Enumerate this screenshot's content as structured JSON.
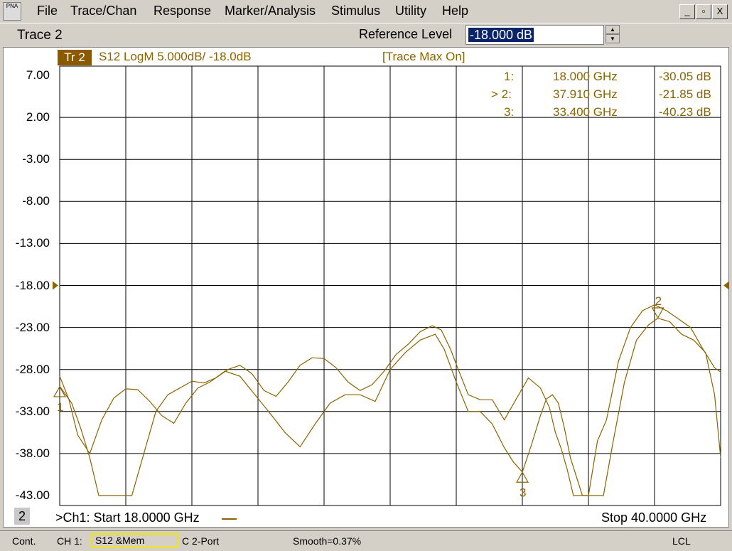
{
  "menu": {
    "app_icon_text": "PNA",
    "items": [
      "File",
      "Trace/Chan",
      "Response",
      "Marker/Analysis",
      "Stimulus",
      "Utility",
      "Help"
    ],
    "window_controls": [
      "_",
      "▫",
      "X"
    ]
  },
  "toolbar": {
    "trace_label": "Trace 2",
    "ref_label": "Reference Level",
    "ref_value": "-18.000 dB"
  },
  "chart_header": {
    "trace_badge": "Tr 2",
    "format": "S12 LogM 5.000dB/  -18.0dB",
    "trace_max": "[Trace Max On]"
  },
  "markers": [
    {
      "num": "1:",
      "freq": "18.000 GHz",
      "val": "-30.05 dB"
    },
    {
      "num": "> 2:",
      "freq": "37.910 GHz",
      "val": "-21.85 dB"
    },
    {
      "num": "3:",
      "freq": "33.400 GHz",
      "val": "-40.23 dB"
    }
  ],
  "chart_data": {
    "type": "line",
    "y_ticks": [
      "7.00",
      "2.00",
      "-3.00",
      "-8.00",
      "-13.00",
      "-18.00",
      "-23.00",
      "-28.00",
      "-33.00",
      "-38.00",
      "-43.00"
    ],
    "ylim": [
      -43,
      7
    ],
    "xlim": [
      18,
      40
    ],
    "x_unit": "GHz",
    "y_unit": "dB",
    "reference_level": -18,
    "grid": true,
    "colors": {
      "trace": "#8b6400",
      "grid": "#000000"
    },
    "series": [
      {
        "x": [
          18.0,
          18.3,
          18.6,
          19.0,
          19.4,
          19.8,
          20.2,
          20.6,
          21.0,
          21.4,
          21.8,
          22.2,
          22.6,
          23.0,
          23.5,
          24.0,
          24.5,
          25.0,
          25.5,
          26.0,
          26.5,
          27.0,
          27.5,
          28.0,
          28.5,
          29.0,
          29.5,
          30.0,
          30.5,
          30.8,
          31.2,
          31.6,
          32.0,
          32.4,
          32.8,
          33.1,
          33.4,
          33.7,
          34.0,
          34.2,
          34.4,
          34.6,
          34.8,
          35.0,
          35.4,
          35.8,
          36.1,
          36.4,
          36.8,
          37.2,
          37.6,
          37.91,
          38.3,
          38.7,
          39.1,
          39.5,
          39.8,
          40.0
        ],
        "y": [
          -28.8,
          -31.5,
          -35.8,
          -38.0,
          -34.0,
          -31.4,
          -30.3,
          -30.4,
          -31.8,
          -33.5,
          -34.4,
          -32.0,
          -30.2,
          -29.5,
          -28.2,
          -28.8,
          -31.0,
          -33.2,
          -35.5,
          -37.2,
          -34.5,
          -32.0,
          -31.0,
          -31.0,
          -31.8,
          -28.0,
          -26.0,
          -24.5,
          -23.8,
          -25.6,
          -29.5,
          -33.0,
          -33.0,
          -34.5,
          -37.3,
          -39.0,
          -40.2,
          -37.0,
          -33.5,
          -31.5,
          -31.0,
          -32.0,
          -35.0,
          -38.5,
          -43.0,
          -43.0,
          -43.0,
          -37.0,
          -29.5,
          -24.5,
          -22.7,
          -21.9,
          -22.3,
          -23.8,
          -24.5,
          -26.0,
          -31.0,
          -38.5
        ]
      },
      {
        "x": [
          18.0,
          18.4,
          18.7,
          19.0,
          19.3,
          19.6,
          20.0,
          20.4,
          20.8,
          21.2,
          21.6,
          22.0,
          22.4,
          22.8,
          23.2,
          23.6,
          24.0,
          24.4,
          24.8,
          25.2,
          25.6,
          26.0,
          26.4,
          26.8,
          27.2,
          27.6,
          28.0,
          28.4,
          28.8,
          29.2,
          29.6,
          30.0,
          30.4,
          30.7,
          31.0,
          31.3,
          31.6,
          32.0,
          32.4,
          32.8,
          33.2,
          33.6,
          34.0,
          34.3,
          34.5,
          34.7,
          34.9,
          35.1,
          35.3,
          35.6,
          35.9,
          36.2,
          36.6,
          37.0,
          37.4,
          37.8,
          38.2,
          38.6,
          39.0,
          39.4,
          39.8,
          40.0
        ],
        "y": [
          -30.0,
          -32.0,
          -35.0,
          -38.5,
          -43.0,
          -43.0,
          -43.0,
          -43.0,
          -38.0,
          -33.0,
          -31.0,
          -30.2,
          -29.4,
          -29.6,
          -29.0,
          -28.0,
          -27.5,
          -28.5,
          -30.5,
          -31.2,
          -29.5,
          -27.5,
          -26.6,
          -26.7,
          -27.8,
          -29.5,
          -30.5,
          -29.8,
          -28.2,
          -26.2,
          -25.0,
          -23.5,
          -22.8,
          -23.3,
          -25.5,
          -28.3,
          -31.0,
          -31.6,
          -31.6,
          -34.0,
          -31.5,
          -29.0,
          -30.2,
          -32.5,
          -35.5,
          -37.5,
          -40.0,
          -43.0,
          -43.0,
          -43.0,
          -36.5,
          -34.0,
          -27.0,
          -23.0,
          -21.0,
          -20.3,
          -21.0,
          -22.0,
          -23.0,
          -25.5,
          -27.8,
          -28.3
        ]
      }
    ],
    "marker_points": [
      {
        "label": "1",
        "x": 18.0,
        "y": -30.05
      },
      {
        "label": "2",
        "x": 37.91,
        "y": -21.85
      },
      {
        "label": "3",
        "x": 33.4,
        "y": -40.23
      }
    ]
  },
  "footer": {
    "channel_num": "2",
    "start": ">Ch1: Start  18.0000 GHz",
    "stop": "Stop  40.0000 GHz"
  },
  "status": {
    "mode": "Cont.",
    "ch": "CH 1:",
    "meas": "S12 &Mem",
    "cal": "C  2-Port",
    "smooth": "Smooth=0.37%",
    "lcl": "LCL"
  }
}
